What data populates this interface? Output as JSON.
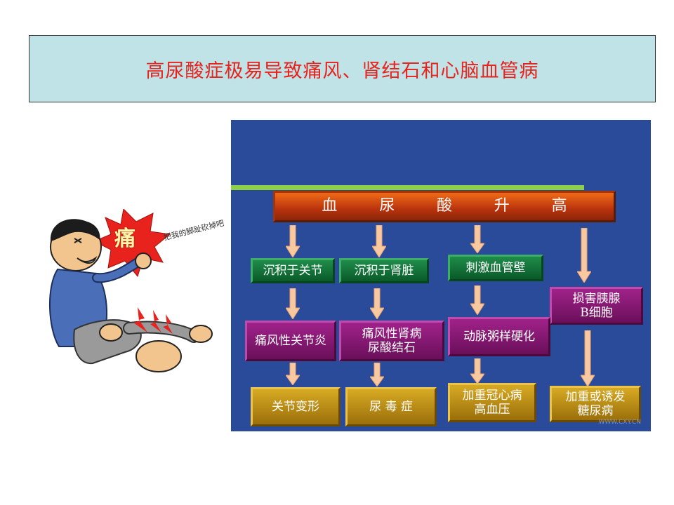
{
  "title": "高尿酸症极易导致痛风、肾结石和心脑血管病",
  "diagram": {
    "root": "血 尿 酸 升 高",
    "level1": [
      "沉积于关节",
      "沉积于肾脏",
      "刺激血管壁"
    ],
    "damage": [
      "损害胰腺",
      "B细胞"
    ],
    "level2": [
      [
        "痛风性关节炎"
      ],
      [
        "痛风性肾病",
        "尿酸结石"
      ],
      [
        "动脉粥样硬化"
      ]
    ],
    "level3": [
      [
        "关节变形"
      ],
      [
        "尿 毒 症"
      ],
      [
        "加重冠心病",
        "高血压"
      ],
      [
        "加重或诱发",
        "糖尿病"
      ]
    ],
    "watermark": "WWW.CXY.CN"
  },
  "illustration": {
    "pain_char": "痛",
    "speech": "把我的脚趾砍掉吧"
  },
  "colors": {
    "title_bg": "#bfe3e6",
    "title_text": "#e8221c",
    "panel_bg": "#2a4a9a",
    "root_box": "#d1490f",
    "green_box": "#0f6e36",
    "purple_box": "#7d1569",
    "gold_box": "#c29419"
  }
}
